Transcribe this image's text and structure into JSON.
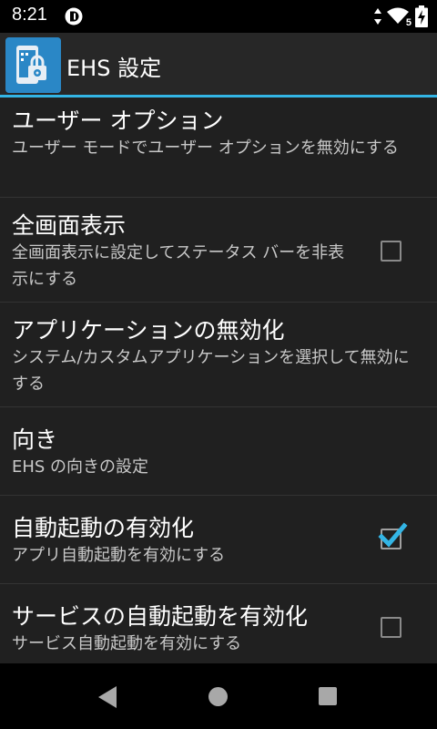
{
  "status_bar": {
    "time": "8:21",
    "signal_badge": "5",
    "icons": [
      "notification-app-icon",
      "data-arrows-icon",
      "wifi-icon",
      "battery-charging-icon"
    ]
  },
  "app_bar": {
    "title": "EHS 設定",
    "accent_color": "#33b5e5",
    "logo_icon": "ehs-lock-phone-icon"
  },
  "preferences": [
    {
      "title": "ユーザー オプション",
      "summary": "ユーザー モードでユーザー オプションを無効にする",
      "checkbox": null
    },
    {
      "title": "全画面表示",
      "summary": "全画面表示に設定してステータス バーを非表示にする",
      "checkbox": false
    },
    {
      "title": "アプリケーションの無効化",
      "summary": "システム/カスタムアプリケーションを選択して無効にする",
      "checkbox": null
    },
    {
      "title": "向き",
      "summary": "EHS の向きの設定",
      "checkbox": null
    },
    {
      "title": "自動起動の有効化",
      "summary": "アプリ自動起動を有効にする",
      "checkbox": true
    },
    {
      "title": "サービスの自動起動を有効化",
      "summary": "サービス自動起動を有効にする",
      "checkbox": false
    }
  ],
  "checkmark_color": "#33b5e5",
  "nav_bar": {
    "icons": [
      "back-icon",
      "home-icon",
      "recents-icon"
    ]
  }
}
